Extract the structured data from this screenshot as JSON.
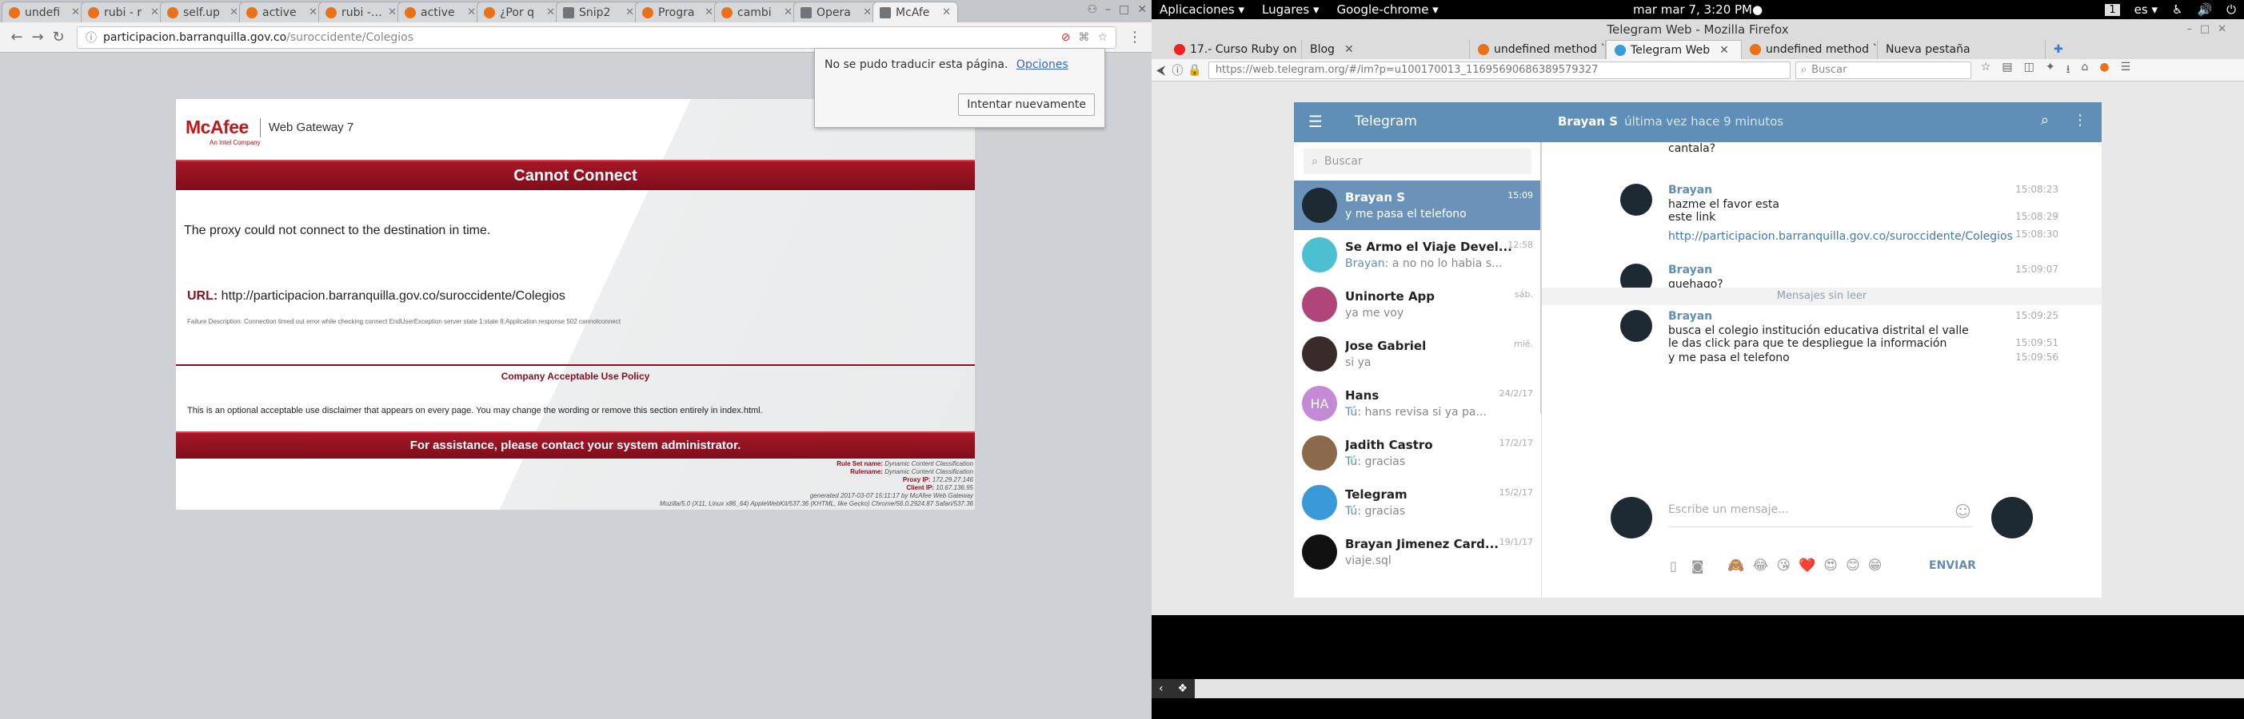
{
  "chrome": {
    "tabs": [
      {
        "label": "undefi"
      },
      {
        "label": "rubi - r"
      },
      {
        "label": "self.up"
      },
      {
        "label": "active"
      },
      {
        "label": "rubi - ®"
      },
      {
        "label": "active"
      },
      {
        "label": "¿Por q"
      },
      {
        "label": "Snip2"
      },
      {
        "label": "Progra"
      },
      {
        "label": "cambi"
      },
      {
        "label": "Opera"
      },
      {
        "label": "McAfe"
      }
    ],
    "url_host": "participacion.barranquilla.gov.co",
    "url_path": "/suroccidente/Colegios",
    "translate_bubble": {
      "text": "No se pudo traducir esta página.",
      "options_link": "Opciones",
      "retry_button": "Intentar nuevamente"
    }
  },
  "mcafee": {
    "logo": "McAfee",
    "logo_sub": "An Intel Company",
    "product": "Web Gateway 7",
    "title": "Cannot Connect",
    "message": "The proxy could not connect to the destination in time.",
    "url_label": "URL:",
    "url_value": "http://participacion.barranquilla.gov.co/suroccidente/Colegios",
    "failure": "Failure Description: Connection timed out error while checking connect EndUserException server state 1:state 8:Application response 502 cannotconnect",
    "policy_title": "Company Acceptable Use Policy",
    "disclaimer": "This is an optional acceptable use disclaimer that appears on every page. You may change the wording or remove this section entirely in index.html.",
    "assistance": "For assistance, please contact your system administrator.",
    "meta": [
      {
        "k": "Rule Set name:",
        "v": "Dynamic Content Classification"
      },
      {
        "k": "Rulename:",
        "v": "Dynamic Content Classification"
      },
      {
        "k": "Proxy IP:",
        "v": "172.29.27.146"
      },
      {
        "k": "Client IP:",
        "v": "10.67.136.95"
      },
      {
        "k": "",
        "v": "generated 2017-03-07 15:11:17 by McAfee Web Gateway"
      },
      {
        "k": "",
        "v": "Mozilla/5.0 (X11, Linux x86_64) AppleWebKit/537.36 (KHTML, like Gecko) Chrome/56.0.2924.87 Safari/537.36"
      }
    ]
  },
  "gnome": {
    "apps": "Aplicaciones ▾",
    "places": "Lugares ▾",
    "active_app": "Google-chrome ▾",
    "clock": "mar mar  7,  3:20 PM●",
    "workspace": "1",
    "lang": "es ▾"
  },
  "firefox": {
    "title": "Telegram Web - Mozilla Firefox",
    "tabs": [
      {
        "label": "17.- Curso Ruby on R...",
        "color": "#e22"
      },
      {
        "label": "Blog",
        "color": ""
      },
      {
        "label": "undefined method `+'...",
        "color": "#e8711a"
      },
      {
        "label": "Telegram Web",
        "color": "#3a9ad9"
      },
      {
        "label": "undefined method `+'...",
        "color": "#e8711a"
      },
      {
        "label": "Nueva pestaña",
        "color": ""
      }
    ],
    "url": "https://web.telegram.org/#/im?p=u100170013_11695690686389579327",
    "search_placeholder": "Buscar"
  },
  "telegram": {
    "brand": "Telegram",
    "peer_name": "Brayan S",
    "peer_status": "última vez hace 9 minutos",
    "search_placeholder": "Buscar",
    "dialogs": [
      {
        "name": "Brayan S",
        "preview": "y me pasa el telefono",
        "who": "",
        "time": "15:09",
        "avatar_text": "",
        "avatar_color": "#1d2a33",
        "active": true
      },
      {
        "name": "Se Armo el Viaje Devel...",
        "preview": "a no no lo habia s...",
        "who": "Brayan:",
        "time": "12:58",
        "avatar_text": "",
        "avatar_color": "#4cc0d1",
        "active": false
      },
      {
        "name": "Uninorte App",
        "preview": "ya me voy",
        "who": "",
        "time": "sáb.",
        "avatar_text": "",
        "avatar_color": "#b0457a",
        "active": false
      },
      {
        "name": "Jose Gabriel",
        "preview": "si ya",
        "who": "",
        "time": "mié.",
        "avatar_text": "",
        "avatar_color": "#3a2a2a",
        "active": false
      },
      {
        "name": "Hans",
        "preview": "hans revisa si ya pa...",
        "who": "Tú:",
        "time": "24/2/17",
        "avatar_text": "HA",
        "avatar_color": "#c48ad6",
        "active": false
      },
      {
        "name": "Jadith Castro",
        "preview": "gracias",
        "who": "Tú:",
        "time": "17/2/17",
        "avatar_text": "",
        "avatar_color": "#8a6a4a",
        "active": false
      },
      {
        "name": "Telegram",
        "preview": "gracias",
        "who": "Tú:",
        "time": "15/2/17",
        "avatar_text": "",
        "avatar_color": "#3a9ad9",
        "active": false
      },
      {
        "name": "Brayan Jimenez Card...",
        "preview": "viaje.sql",
        "who": "",
        "time": "19/1/17",
        "avatar_text": "",
        "avatar_color": "#111",
        "active": false
      }
    ],
    "messages": [
      {
        "author": "",
        "text": "cantala?",
        "time": ""
      },
      {
        "author": "Brayan",
        "text": "hazme el favor esta",
        "time": "15:08:23"
      },
      {
        "author": "",
        "text": "este link",
        "time": "15:08:29"
      },
      {
        "author": "",
        "text": "http://participacion.barranquilla.gov.co/suroccidente/Colegios",
        "time": "15:08:30"
      },
      {
        "author": "Brayan",
        "text": "quehago?",
        "time": "15:09:07"
      },
      {
        "author": "Brayan",
        "text": "busca el colegio institución educativa distrital el valle",
        "time": "15:09:25"
      },
      {
        "author": "",
        "text": "le das click para que te despliegue la información",
        "time": "15:09:51"
      },
      {
        "author": "",
        "text": "y me pasa el telefono",
        "time": "15:09:56"
      }
    ],
    "unread_label": "Mensajes sin leer",
    "compose_placeholder": "Escribe un mensaje...",
    "send_label": "ENVIAR",
    "emojis": [
      "🙈",
      "😂",
      "😘",
      "❤️",
      "😍",
      "😊",
      "😁"
    ]
  }
}
